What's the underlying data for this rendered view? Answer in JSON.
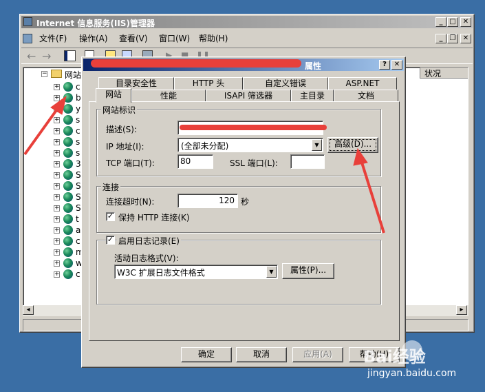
{
  "iis": {
    "title": "Internet 信息服务(IIS)管理器",
    "menu": [
      "文件(F)",
      "操作(A)",
      "查看(V)",
      "窗口(W)",
      "帮助(H)"
    ],
    "tree_root": "网站",
    "tree_items": [
      "c",
      "b",
      "y",
      "s",
      "c",
      "s",
      "s",
      "3",
      "S",
      "S",
      "S",
      "S",
      "t",
      "a",
      "c",
      "m",
      "w",
      "c"
    ],
    "column_status": "状况"
  },
  "dialog": {
    "title": "属性",
    "tabs_row1": [
      "目录安全性",
      "HTTP 头",
      "自定义错误",
      "ASP.NET"
    ],
    "tabs_row2": [
      "网站",
      "性能",
      "ISAPI 筛选器",
      "主目录",
      "文档"
    ],
    "site_id_group": "网站标识",
    "description_label": "描述(S):",
    "ip_label": "IP 地址(I):",
    "ip_value": "(全部未分配)",
    "advanced_button": "高级(D)...",
    "tcp_label": "TCP 端口(T):",
    "tcp_value": "80",
    "ssl_label": "SSL 端口(L):",
    "ssl_value": "",
    "connection_group": "连接",
    "timeout_label": "连接超时(N):",
    "timeout_value": "120",
    "timeout_unit": "秒",
    "keepalive_label": "保持 HTTP 连接(K)",
    "logging_label": "启用日志记录(E)",
    "log_format_label": "活动日志格式(V):",
    "log_format_value": "W3C 扩展日志文件格式",
    "log_properties_button": "属性(P)...",
    "ok_button": "确定",
    "cancel_button": "取消",
    "apply_button": "应用(A)",
    "help_button": "帮助(H)"
  },
  "watermark": {
    "brand": "Bai经验",
    "url": "jingyan.baidu.com"
  },
  "colors": {
    "desktop": "#3a6ea5",
    "titlebar": "#0a246a",
    "annotation_red": "#e8403a"
  }
}
